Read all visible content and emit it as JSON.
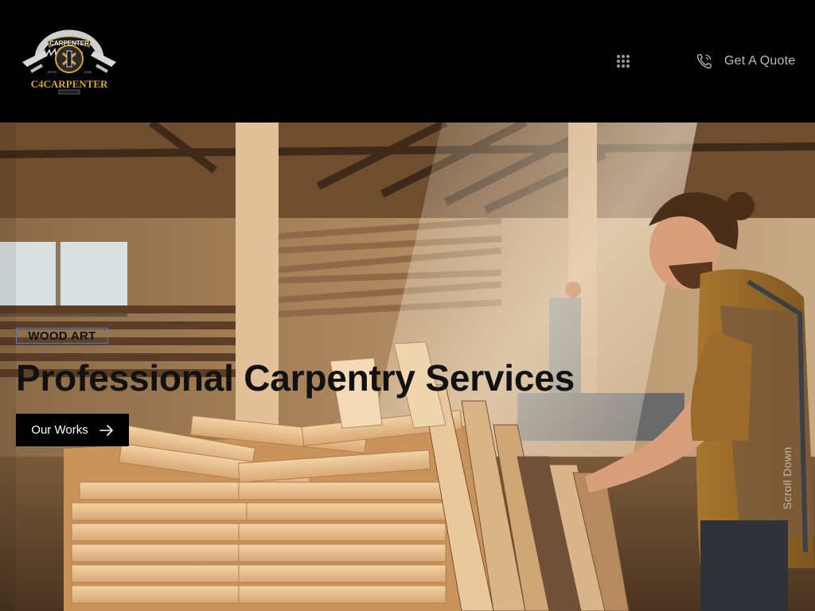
{
  "header": {
    "logo": {
      "arc_text": "CARPENTER",
      "brand": "C4CARPENTER",
      "est_left": "ESTD",
      "est_right": "2025",
      "colors": {
        "gold": "#d7a53b",
        "silver": "#cfcfcf"
      }
    },
    "menu_icon": "grid-dots-icon",
    "quote": {
      "icon": "phone-icon",
      "label": "Get A Quote"
    }
  },
  "hero": {
    "tag": "WOOD ART",
    "title": "Professional Carpentry Services",
    "cta": {
      "label": "Our Works",
      "icon": "arrow-right-icon"
    },
    "scroll_label": "Scroll Down",
    "photo_description_icon": "carpentry-workshop-photo"
  },
  "colors": {
    "header_bg": "#000000",
    "text_dark": "#111111",
    "tag_border": "#4c7ccf",
    "button_bg": "#000000",
    "button_text": "#ffffff",
    "quote_text": "#bdbdbd"
  }
}
